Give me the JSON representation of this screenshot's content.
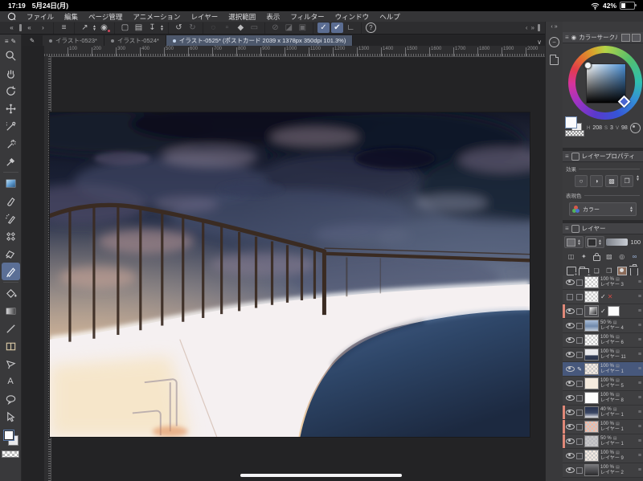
{
  "status_bar": {
    "time": "17:19",
    "date": "5月24日(月)",
    "battery": "42%"
  },
  "menu_bar": {
    "items": [
      "ファイル",
      "編集",
      "ページ管理",
      "アニメーション",
      "レイヤー",
      "選択範囲",
      "表示",
      "フィルター",
      "ウィンドウ",
      "ヘルプ"
    ]
  },
  "toolbar": {
    "help_label": "?"
  },
  "tab_bar": {
    "tabs": [
      {
        "label": "イラスト-0523*",
        "active": false
      },
      {
        "label": "イラスト-0524*",
        "active": false
      },
      {
        "label": "イラスト-0525* (ポストカード 2039 x 1378px 350dpi 101.3%)",
        "active": true
      }
    ]
  },
  "ruler": {
    "labels": [
      "100",
      "200",
      "300",
      "400",
      "500",
      "600",
      "700",
      "800",
      "900",
      "1000",
      "1100",
      "1200",
      "1300",
      "1400",
      "1500",
      "1600",
      "1700",
      "1800",
      "1900",
      "2000"
    ]
  },
  "tool_palette": {
    "selected_tool": "pen"
  },
  "color_panel": {
    "title": "カラーサークル",
    "hue_label": "H",
    "hue": "208",
    "sat_label": "S",
    "sat": "3",
    "val_label": "V",
    "val": "98"
  },
  "layer_property_panel": {
    "title": "レイヤープロパティ",
    "effect_label": "効果",
    "expression_label": "表現色",
    "expression_value": "カラー"
  },
  "layers_panel": {
    "title": "レイヤー",
    "opacity": "100",
    "rows": [
      {
        "type": "normal",
        "eye": true,
        "thumb": "checker",
        "opacity": "100 %",
        "name": "レイヤー 3"
      },
      {
        "type": "draft",
        "eye": false,
        "thumb": "checker",
        "check": "✓",
        "cross": "✕"
      },
      {
        "type": "mask",
        "eye": true,
        "red_bar": true,
        "thumb": "gradsq",
        "check": "✓"
      },
      {
        "type": "normal",
        "eye": true,
        "thumb": "sky",
        "opacity": "50 %",
        "name": "レイヤー 4"
      },
      {
        "type": "normal",
        "eye": true,
        "thumb": "checker",
        "opacity": "100 %",
        "name": "レイヤー 6"
      },
      {
        "type": "normal",
        "eye": true,
        "thumb": "darkshape",
        "opacity": "100 %",
        "name": "レイヤー 11"
      },
      {
        "type": "normal",
        "eye": true,
        "selected": true,
        "editing": true,
        "thumb": "checker-light",
        "opacity": "100 %",
        "name": "レイヤー 1"
      },
      {
        "type": "normal",
        "eye": true,
        "thumb": "light",
        "opacity": "100 %",
        "name": "レイヤー 5"
      },
      {
        "type": "normal",
        "eye": true,
        "thumb": "white",
        "opacity": "100 %",
        "name": "レイヤー 8"
      },
      {
        "type": "normal",
        "eye": true,
        "red_bar": true,
        "thumb": "clouddark",
        "opacity": "40 %",
        "name": "レイヤー 1"
      },
      {
        "type": "normal",
        "eye": true,
        "red_bar": true,
        "thumb": "salmon",
        "opacity": "100 %",
        "name": "レイヤー 1"
      },
      {
        "type": "normal",
        "eye": true,
        "red_bar": true,
        "thumb": "cloudgray",
        "opacity": "50 %",
        "name": "レイヤー 1"
      },
      {
        "type": "normal",
        "eye": true,
        "thumb": "checker-light",
        "opacity": "100 %",
        "name": "レイヤー 9"
      },
      {
        "type": "normal",
        "eye": true,
        "thumb": "graddark",
        "opacity": "100 %",
        "name": "レイヤー 2"
      }
    ]
  },
  "colors": {
    "selection_blue": "#47587c",
    "active_tool_blue": "#5b6f96",
    "layer_label_red": "#e08878",
    "active_tab_blue": "#4d586c"
  }
}
